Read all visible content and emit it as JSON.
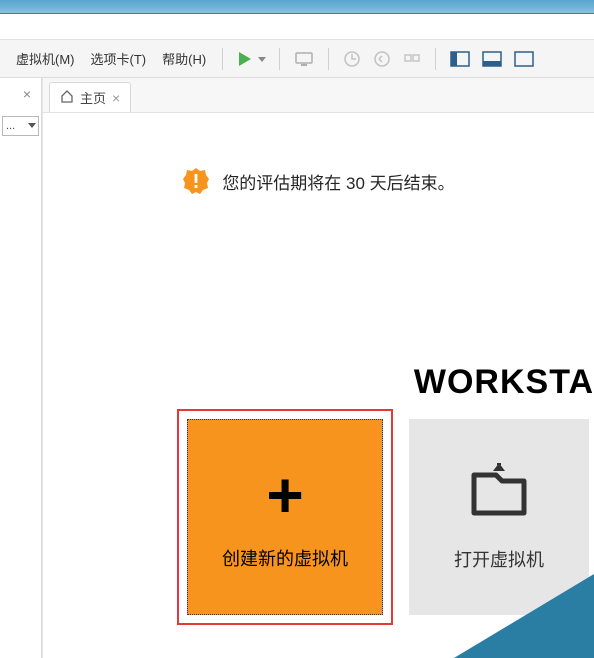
{
  "menu": {
    "vm": "虚拟机(M)",
    "tabs": "选项卡(T)",
    "help": "帮助(H)"
  },
  "tab": {
    "home_label": "主页"
  },
  "notice": {
    "text": "您的评估期将在 30 天后结束。"
  },
  "brand": "WORKSTA",
  "actions": {
    "create_label": "创建新的虚拟机",
    "open_label": "打开虚拟机"
  }
}
